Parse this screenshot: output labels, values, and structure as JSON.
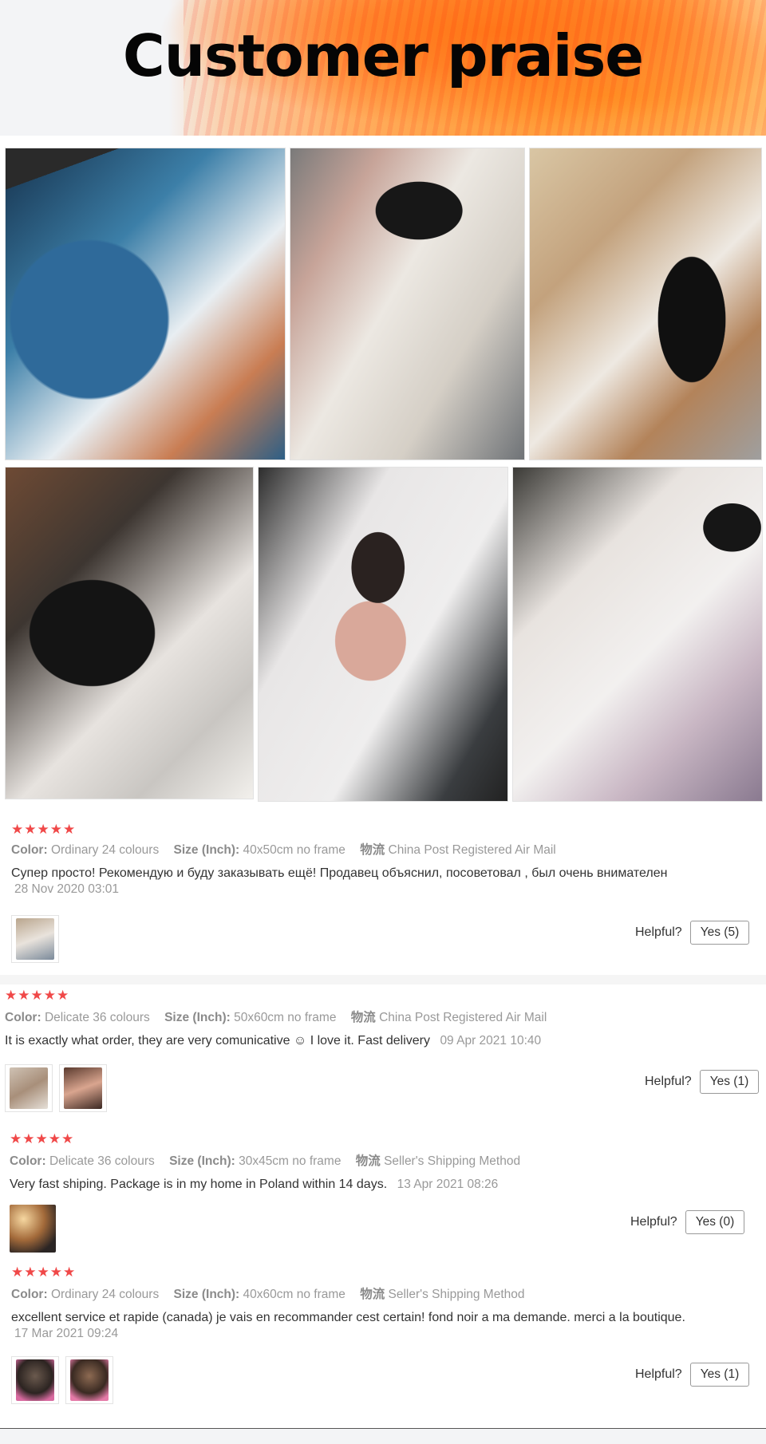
{
  "banner": {
    "title": "Customer praise"
  },
  "photos": [
    {
      "icon": "customer-photo"
    },
    {
      "icon": "customer-photo"
    },
    {
      "icon": "customer-photo"
    },
    {
      "icon": "customer-photo"
    },
    {
      "icon": "customer-photo"
    },
    {
      "icon": "customer-photo"
    }
  ],
  "colors": {
    "star": "#f04848",
    "meta": "#999999",
    "text": "#333333"
  },
  "reviews": [
    {
      "stars": "★★★★★",
      "color_label": "Color:",
      "color_value": "Ordinary 24 colours",
      "size_label": "Size (Inch):",
      "size_value": "40x50cm no frame",
      "ship_label": "物流",
      "ship_value": "China Post Registered Air Mail",
      "text": "Супер просто! Рекомендую и буду заказывать ещё! Продавец объяснил, посоветовал , был очень внимателен",
      "date": "28 Nov 2020 03:01",
      "helpful_label": "Helpful?",
      "yes_label": "Yes (5)"
    },
    {
      "stars": "★★★★★",
      "color_label": "Color:",
      "color_value": "Delicate 36 colours",
      "size_label": "Size (Inch):",
      "size_value": "50x60cm no frame",
      "ship_label": "物流",
      "ship_value": "China Post Registered Air Mail",
      "text": "It is exactly what order, they are very comunicative ☺ I love it. Fast delivery",
      "date": "09 Apr 2021 10:40",
      "helpful_label": "Helpful?",
      "yes_label": "Yes (1)"
    },
    {
      "stars": "★★★★★",
      "color_label": "Color:",
      "color_value": "Delicate 36 colours",
      "size_label": "Size (Inch):",
      "size_value": "30x45cm no frame",
      "ship_label": "物流",
      "ship_value": "Seller's Shipping Method",
      "text": "Very fast shiping. Package is in my home in Poland within 14 days.",
      "date": "13 Apr 2021 08:26",
      "helpful_label": "Helpful?",
      "yes_label": "Yes (0)"
    },
    {
      "stars": "★★★★★",
      "color_label": "Color:",
      "color_value": "Ordinary 24 colours",
      "size_label": "Size (Inch):",
      "size_value": "40x60cm no frame",
      "ship_label": "物流",
      "ship_value": "Seller's Shipping Method",
      "text": "excellent service et rapide (canada) je vais en recommander cest certain! fond noir a ma demande. merci a la boutique.",
      "date": "17 Mar 2021 09:24",
      "helpful_label": "Helpful?",
      "yes_label": "Yes (1)"
    }
  ]
}
